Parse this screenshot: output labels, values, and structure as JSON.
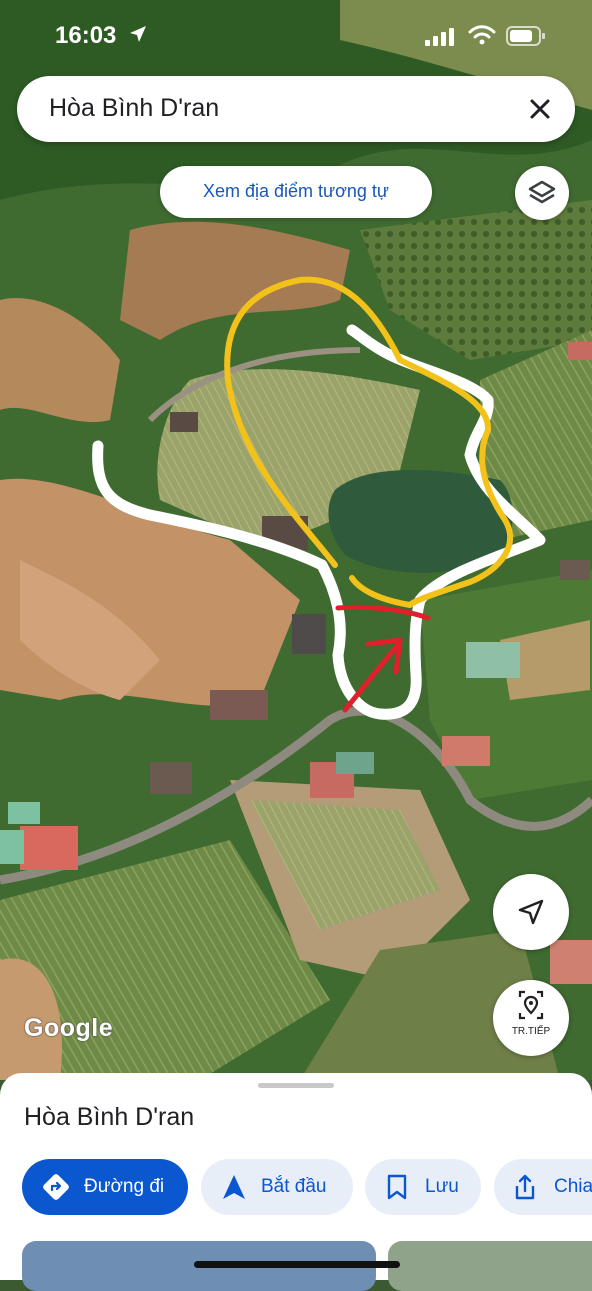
{
  "status_bar": {
    "time": "16:03"
  },
  "search": {
    "query": "Hòa Bình D'ran"
  },
  "map": {
    "suggest_chip": "Xem địa điểm tương tự",
    "tracking_label": "TR.TIẾP",
    "logo": "Google",
    "colors": {
      "annotation_yellow": "#f2c21b",
      "annotation_white": "#ffffff",
      "annotation_red": "#e0202a"
    }
  },
  "place": {
    "name": "Hòa Bình D'ran",
    "actions": [
      {
        "label": "Đường đi",
        "icon": "directions-icon"
      },
      {
        "label": "Bắt đầu",
        "icon": "navigation-arrow-icon"
      },
      {
        "label": "Lưu",
        "icon": "bookmark-icon"
      },
      {
        "label": "Chia",
        "icon": "share-icon"
      }
    ]
  },
  "colors": {
    "accent": "#0b57d0",
    "chip_text": "#1a57b7",
    "secondary_button_bg": "#e8eef8"
  }
}
